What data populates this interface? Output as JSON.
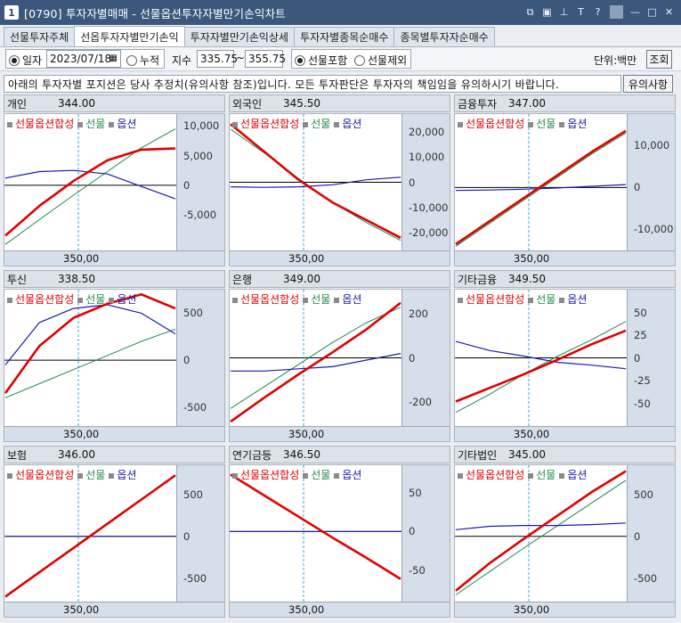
{
  "window": {
    "badge": "1",
    "title": "[0790] 투자자별매매 - 선물옵션투자자별만기손익차트",
    "controls": [
      "restore-icon",
      "tile-icon",
      "pin-icon",
      "font-icon",
      "help-icon",
      "minimize-icon",
      "maximize-icon",
      "close-icon"
    ],
    "control_glyphs": [
      "⧉",
      "▣",
      "⊥",
      "T",
      "?",
      "—",
      "□",
      "✕"
    ]
  },
  "tabs": [
    "선물투자주체",
    "선옵투자자별만기손익",
    "투자자별만기손익상세",
    "투자자별종목순매수",
    "종목별투자자순매수"
  ],
  "active_tab": 1,
  "toolbar": {
    "daily_label": "일자",
    "date_value": "2023/07/18",
    "cumulative_label": "누적",
    "index_label": "지수",
    "index_from": "335.75",
    "tilde": "~",
    "index_to": "355.75",
    "include_futures_label": "선물포함",
    "exclude_futures_label": "선물제외",
    "unit_label": "단위:백만",
    "query_button": "조회"
  },
  "notice": {
    "text": "아래의 투자자별 포지션은 당사 추정치(유의사항 참조)입니다. 모든 투자판단은 투자자의 책임임을 유의하시기 바랍니다.",
    "button": "유의사항"
  },
  "legend": {
    "combined": "선물옵션합성",
    "futures": "선물",
    "options": "옵션"
  },
  "colors": {
    "combined": "#e00000",
    "futures": "#1e8a4a",
    "options": "#1a1ab0",
    "axis_bg": "#d5dfeb",
    "title_bar": "#3b587c"
  },
  "chart_data": [
    {
      "name": "개인",
      "value": "344.00",
      "type": "line",
      "x_tick": "350,00",
      "yticks": [
        "10,000",
        "5,000",
        "0",
        "-5,000"
      ],
      "ytick_vals": [
        10000,
        5000,
        0,
        -5000
      ],
      "ylim": [
        -11000,
        12000
      ],
      "series": [
        {
          "name": "선물옵션합성",
          "values": [
            -8500,
            -3500,
            700,
            4200,
            6000,
            6200
          ]
        },
        {
          "name": "선물",
          "values": [
            -10000,
            -5800,
            -1700,
            2300,
            6300,
            9500
          ]
        },
        {
          "name": "옵션",
          "values": [
            1200,
            2300,
            2500,
            1900,
            -200,
            -2300
          ]
        }
      ]
    },
    {
      "name": "외국인",
      "value": "345.50",
      "type": "line",
      "x_tick": "350,00",
      "yticks": [
        "20,000",
        "10,000",
        "0",
        "-10,000",
        "-20,000"
      ],
      "ytick_vals": [
        20000,
        10000,
        0,
        -10000,
        -20000
      ],
      "ylim": [
        -27000,
        27000
      ],
      "series": [
        {
          "name": "선물옵션합성",
          "values": [
            23000,
            12000,
            1000,
            -8000,
            -15000,
            -22000
          ]
        },
        {
          "name": "선물",
          "values": [
            21000,
            11500,
            1500,
            -8000,
            -16000,
            -23000
          ]
        },
        {
          "name": "옵션",
          "values": [
            -1800,
            -2000,
            -1800,
            -1000,
            1000,
            2000
          ]
        }
      ]
    },
    {
      "name": "금융투자",
      "value": "347.00",
      "type": "line",
      "x_tick": "350,00",
      "yticks": [
        "10,000",
        "0",
        "-10,000"
      ],
      "ytick_vals": [
        10000,
        0,
        -10000
      ],
      "ylim": [
        -15000,
        17500
      ],
      "series": [
        {
          "name": "선물옵션합성",
          "values": [
            -13500,
            -8000,
            -2500,
            3000,
            8500,
            13500
          ]
        },
        {
          "name": "선물",
          "values": [
            -14000,
            -8500,
            -3000,
            2500,
            8000,
            13000
          ]
        },
        {
          "name": "옵션",
          "values": [
            -700,
            -600,
            -400,
            -100,
            300,
            700
          ]
        }
      ]
    },
    {
      "name": "투신",
      "value": "338.50",
      "type": "line",
      "x_tick": "350,00",
      "yticks": [
        "500",
        "0",
        "-500"
      ],
      "ytick_vals": [
        500,
        0,
        -500
      ],
      "ylim": [
        -700,
        750
      ],
      "series": [
        {
          "name": "선물옵션합성",
          "values": [
            -350,
            150,
            450,
            600,
            700,
            550
          ]
        },
        {
          "name": "선물",
          "values": [
            -400,
            -250,
            -100,
            50,
            200,
            330
          ]
        },
        {
          "name": "옵션",
          "values": [
            -50,
            400,
            550,
            590,
            500,
            280
          ]
        }
      ]
    },
    {
      "name": "은행",
      "value": "349.00",
      "type": "line",
      "x_tick": "350,00",
      "yticks": [
        "200",
        "0",
        "-200"
      ],
      "ytick_vals": [
        200,
        0,
        -200
      ],
      "ylim": [
        -310,
        310
      ],
      "series": [
        {
          "name": "선물옵션합성",
          "values": [
            -290,
            -180,
            -75,
            25,
            130,
            250
          ]
        },
        {
          "name": "선물",
          "values": [
            -230,
            -130,
            -30,
            70,
            160,
            230
          ]
        },
        {
          "name": "옵션",
          "values": [
            -60,
            -60,
            -50,
            -40,
            -10,
            20
          ]
        }
      ]
    },
    {
      "name": "기타금융",
      "value": "349.50",
      "type": "line",
      "x_tick": "350,00",
      "yticks": [
        "50",
        "25",
        "0",
        "-25",
        "-50"
      ],
      "ytick_vals": [
        50,
        25,
        0,
        -25,
        -50
      ],
      "ylim": [
        -75,
        75
      ],
      "series": [
        {
          "name": "선물옵션합성",
          "values": [
            -48,
            -33,
            -18,
            -2,
            15,
            30
          ]
        },
        {
          "name": "선물",
          "values": [
            -60,
            -40,
            -18,
            2,
            20,
            40
          ]
        },
        {
          "name": "옵션",
          "values": [
            18,
            8,
            2,
            -5,
            -8,
            -12
          ]
        }
      ]
    },
    {
      "name": "보험",
      "value": "346.00",
      "type": "line",
      "x_tick": "350,00",
      "yticks": [
        "500",
        "0",
        "-500"
      ],
      "ytick_vals": [
        500,
        0,
        -500
      ],
      "ylim": [
        -780,
        850
      ],
      "series": [
        {
          "name": "선물옵션합성",
          "values": [
            -720,
            -430,
            -140,
            150,
            440,
            730
          ]
        },
        {
          "name": "선물",
          "values": [
            -720,
            -430,
            -140,
            150,
            440,
            730
          ]
        },
        {
          "name": "옵션",
          "values": [
            0,
            0,
            0,
            0,
            0,
            0
          ]
        }
      ]
    },
    {
      "name": "연기금등",
      "value": "346.50",
      "type": "line",
      "x_tick": "350,00",
      "yticks": [
        "50",
        "0",
        "-50"
      ],
      "ytick_vals": [
        50,
        0,
        -50
      ],
      "ylim": [
        -90,
        85
      ],
      "series": [
        {
          "name": "선물옵션합성",
          "values": [
            73,
            46,
            19,
            -8,
            -34,
            -61
          ]
        },
        {
          "name": "선물",
          "values": [
            73,
            46,
            19,
            -8,
            -34,
            -61
          ]
        },
        {
          "name": "옵션",
          "values": [
            0,
            0,
            0,
            0,
            0,
            0
          ]
        }
      ]
    },
    {
      "name": "기타법인",
      "value": "345.00",
      "type": "line",
      "x_tick": "350,00",
      "yticks": [
        "500",
        "0",
        "-500"
      ],
      "ytick_vals": [
        500,
        0,
        -500
      ],
      "ylim": [
        -780,
        850
      ],
      "series": [
        {
          "name": "선물옵션합성",
          "values": [
            -650,
            -320,
            -30,
            250,
            530,
            780
          ]
        },
        {
          "name": "선물",
          "values": [
            -700,
            -420,
            -140,
            130,
            400,
            670
          ]
        },
        {
          "name": "옵션",
          "values": [
            80,
            120,
            130,
            130,
            140,
            160
          ]
        }
      ]
    }
  ]
}
